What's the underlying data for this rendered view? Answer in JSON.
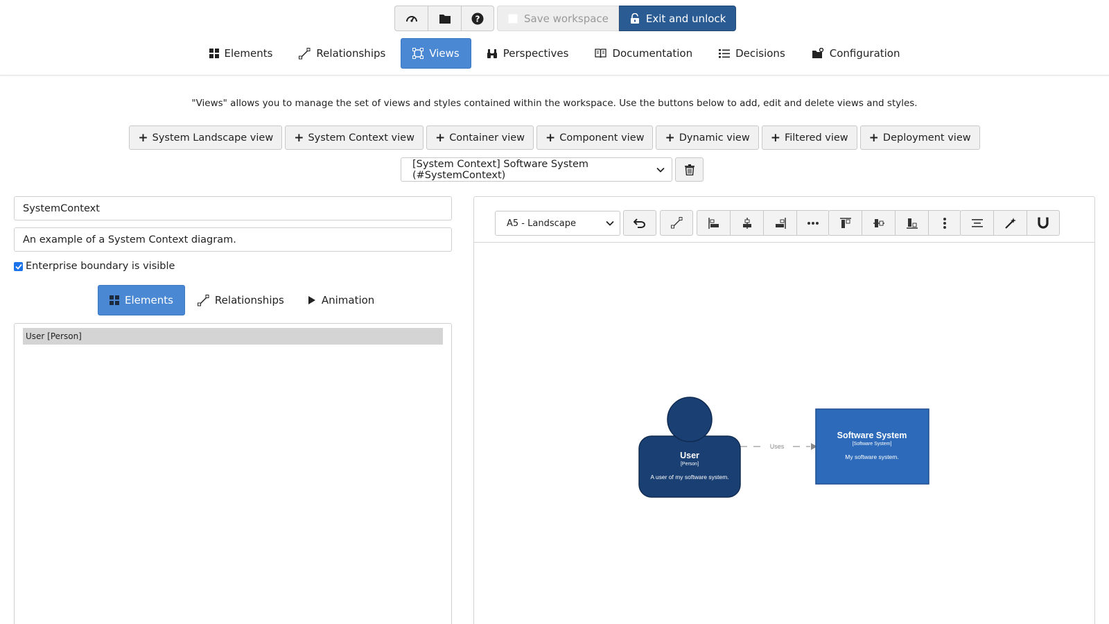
{
  "top_toolbar": {
    "icons": [
      "dashboard-icon",
      "folder-icon",
      "help-icon"
    ],
    "save_label": "Save workspace",
    "exit_label": "Exit and unlock"
  },
  "nav": {
    "items": [
      {
        "label": "Elements",
        "icon": "grid-icon"
      },
      {
        "label": "Relationships",
        "icon": "relationship-icon"
      },
      {
        "label": "Views",
        "icon": "views-icon",
        "active": true
      },
      {
        "label": "Perspectives",
        "icon": "binoculars-icon"
      },
      {
        "label": "Documentation",
        "icon": "book-icon"
      },
      {
        "label": "Decisions",
        "icon": "list-icon"
      },
      {
        "label": "Configuration",
        "icon": "configuration-icon"
      }
    ]
  },
  "intro": "\"Views\" allows you to manage the set of views and styles contained within the workspace. Use the buttons below to add, edit and delete views and styles.",
  "add_view_buttons": [
    "System Landscape view",
    "System Context view",
    "Container view",
    "Component view",
    "Dynamic view",
    "Filtered view",
    "Deployment view"
  ],
  "view_select": {
    "selected": "[System Context] Software System (#SystemContext)"
  },
  "view_form": {
    "key": "SystemContext",
    "description": "An example of a System Context diagram.",
    "enterprise_boundary_label": "Enterprise boundary is visible",
    "enterprise_boundary_checked": true
  },
  "sub_tabs": [
    {
      "label": "Elements",
      "active": true
    },
    {
      "label": "Relationships"
    },
    {
      "label": "Animation"
    }
  ],
  "element_list": [
    "User [Person]"
  ],
  "diagram_toolbar": {
    "paper_size": "A5 - Landscape"
  },
  "diagram": {
    "person": {
      "name": "User",
      "type": "[Person]",
      "description": "A user of my software system."
    },
    "system": {
      "name": "Software System",
      "type": "[Software System]",
      "description": "My software system."
    },
    "relationship": {
      "label": "Uses"
    },
    "colors": {
      "person": "#1a3f73",
      "system": "#2d6bba",
      "accent": "#4a88d4",
      "exit_button": "#2b5b93"
    }
  }
}
